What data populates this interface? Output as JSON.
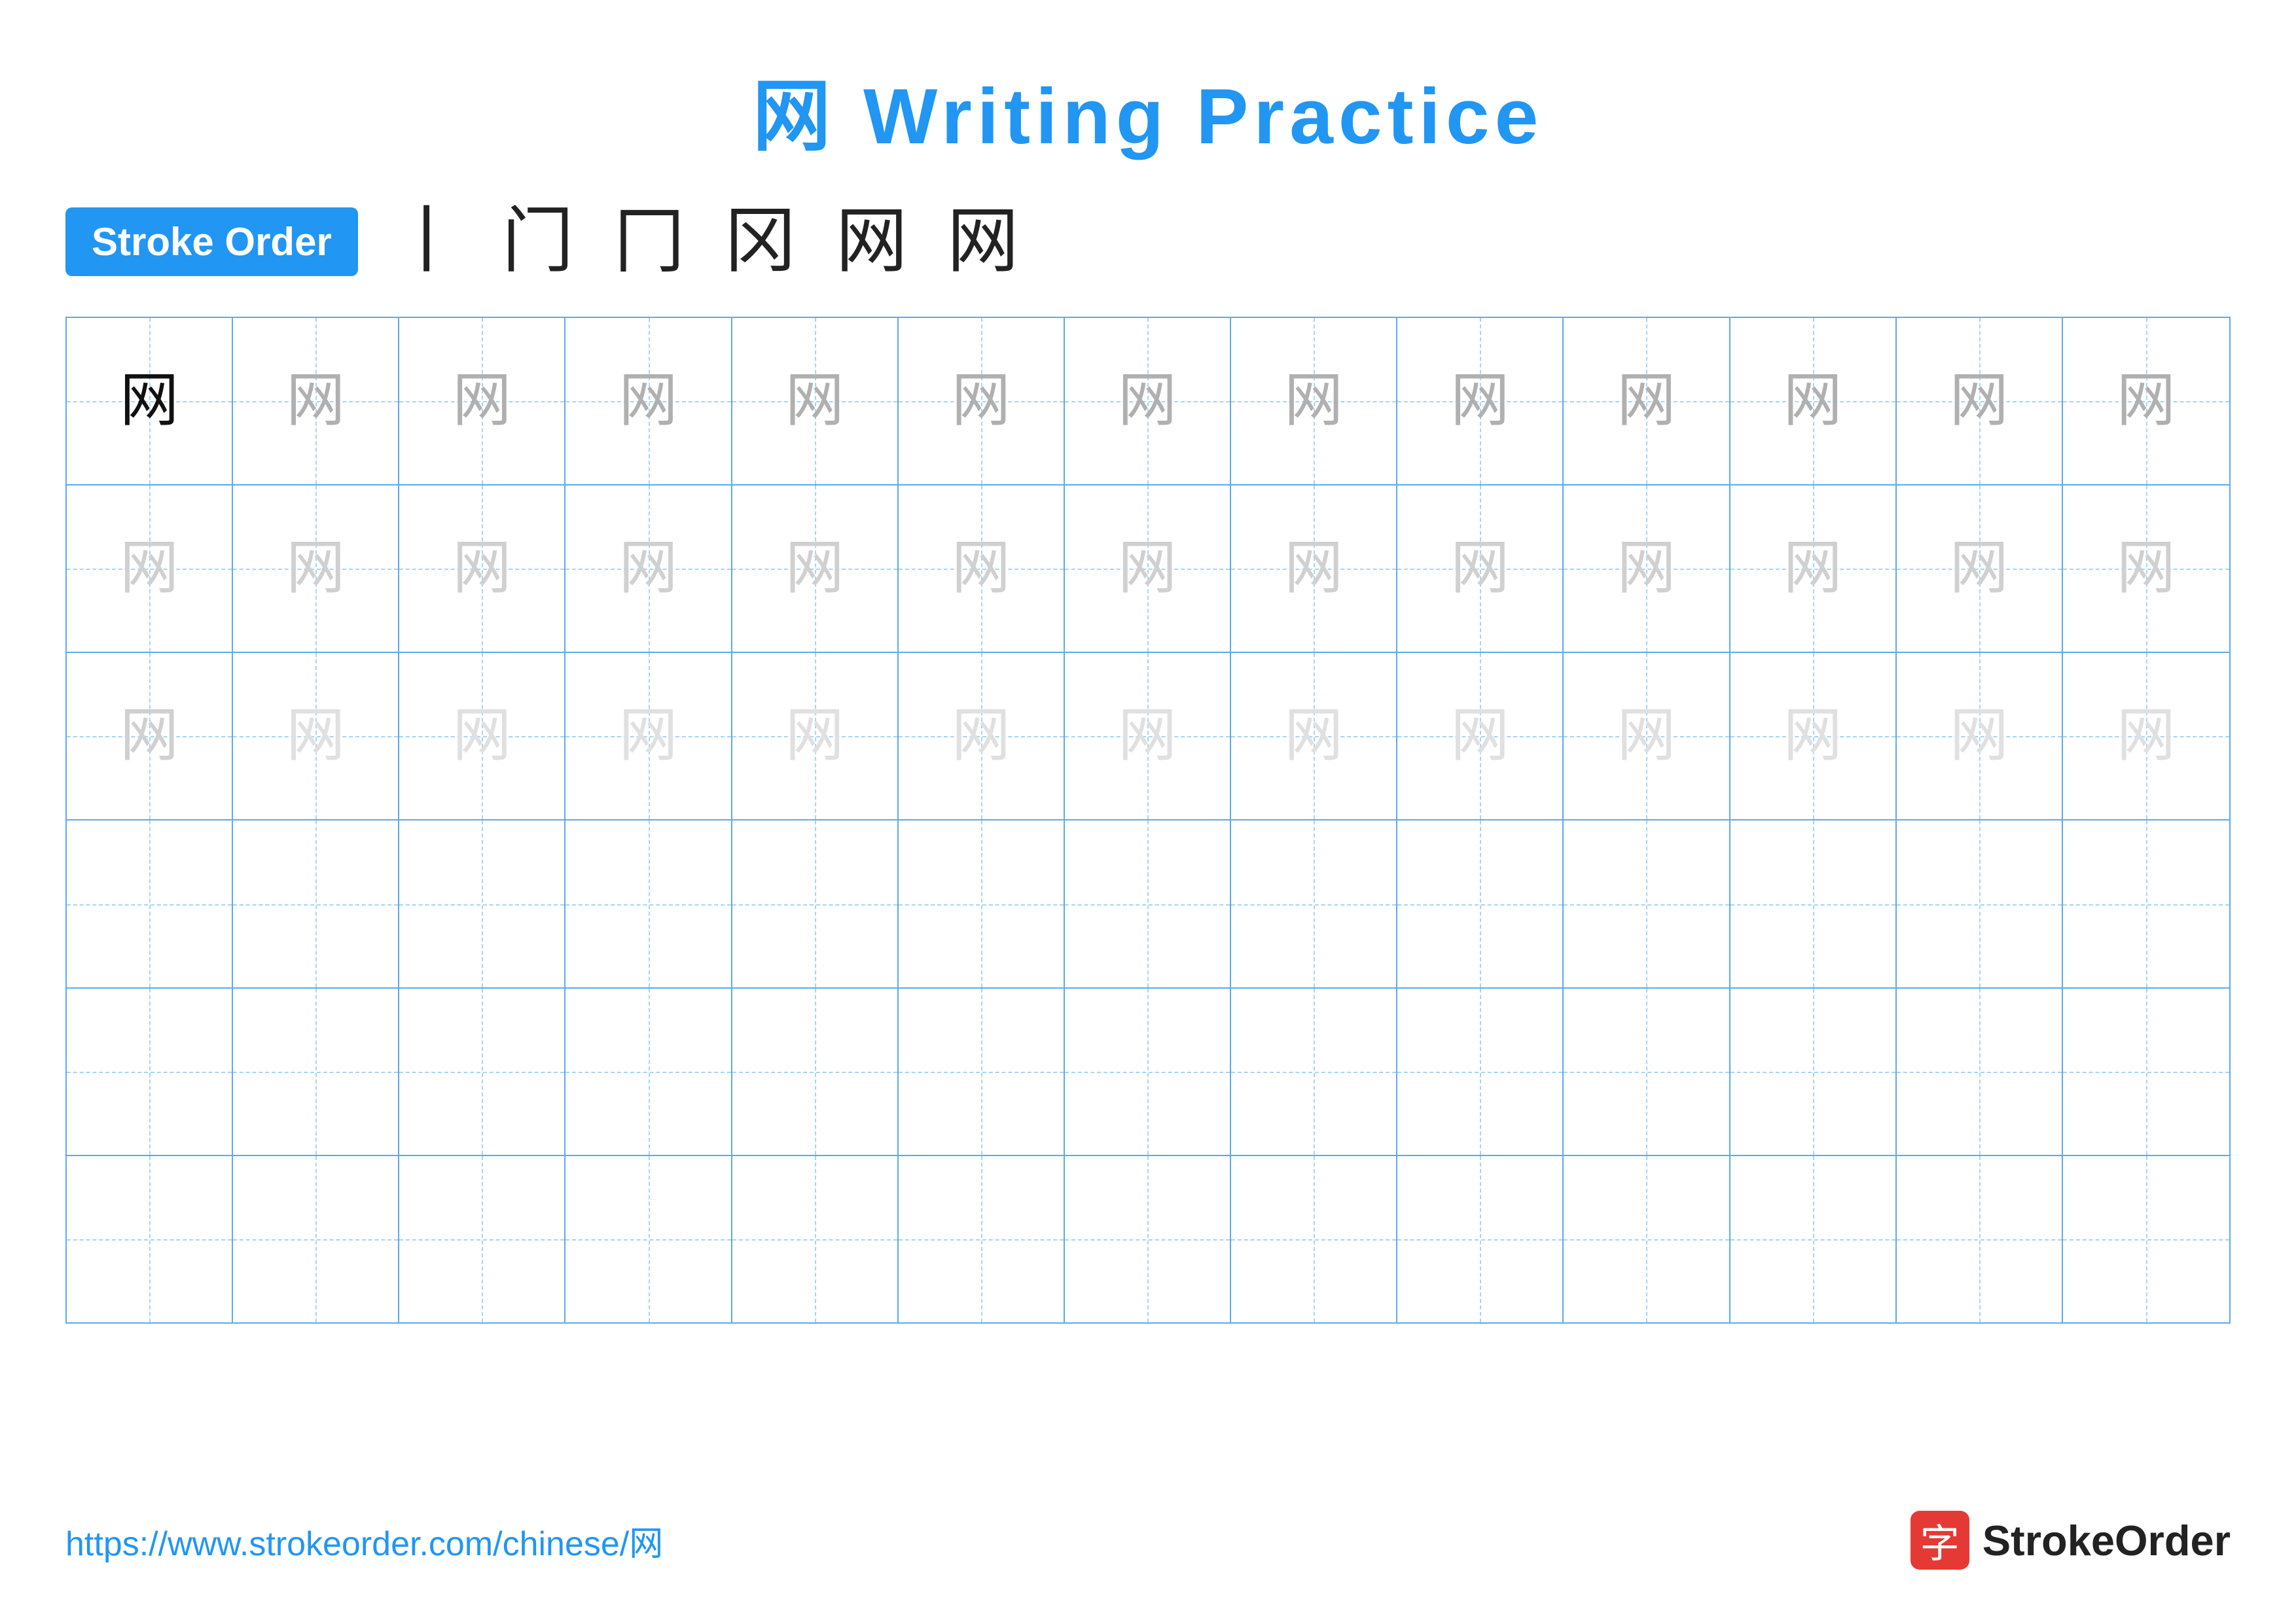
{
  "title": {
    "chinese_char": "网",
    "text": "Writing Practice",
    "full": "网 Writing Practice"
  },
  "stroke_order": {
    "badge_label": "Stroke Order",
    "steps": [
      "丨",
      "门",
      "冂",
      "冈",
      "网",
      "网"
    ]
  },
  "grid": {
    "rows": 6,
    "cols": 13,
    "char": "网",
    "row_data": [
      {
        "type": "example",
        "cells": [
          "dark",
          "medium-gray",
          "medium-gray",
          "medium-gray",
          "medium-gray",
          "medium-gray",
          "medium-gray",
          "medium-gray",
          "medium-gray",
          "medium-gray",
          "medium-gray",
          "medium-gray",
          "medium-gray"
        ]
      },
      {
        "type": "practice",
        "cells": [
          "light-gray",
          "light-gray",
          "light-gray",
          "light-gray",
          "light-gray",
          "light-gray",
          "light-gray",
          "light-gray",
          "light-gray",
          "light-gray",
          "light-gray",
          "light-gray",
          "light-gray"
        ]
      },
      {
        "type": "practice",
        "cells": [
          "light-gray",
          "very-light-gray",
          "very-light-gray",
          "very-light-gray",
          "very-light-gray",
          "very-light-gray",
          "very-light-gray",
          "very-light-gray",
          "very-light-gray",
          "very-light-gray",
          "very-light-gray",
          "very-light-gray",
          "very-light-gray"
        ]
      },
      {
        "type": "empty",
        "cells": [
          "",
          "",
          "",
          "",
          "",
          "",
          "",
          "",
          "",
          "",
          "",
          "",
          ""
        ]
      },
      {
        "type": "empty",
        "cells": [
          "",
          "",
          "",
          "",
          "",
          "",
          "",
          "",
          "",
          "",
          "",
          "",
          ""
        ]
      },
      {
        "type": "empty",
        "cells": [
          "",
          "",
          "",
          "",
          "",
          "",
          "",
          "",
          "",
          "",
          "",
          "",
          ""
        ]
      }
    ]
  },
  "footer": {
    "url": "https://www.strokeorder.com/chinese/网",
    "logo_text": "StrokeOrder",
    "logo_icon": "字"
  }
}
